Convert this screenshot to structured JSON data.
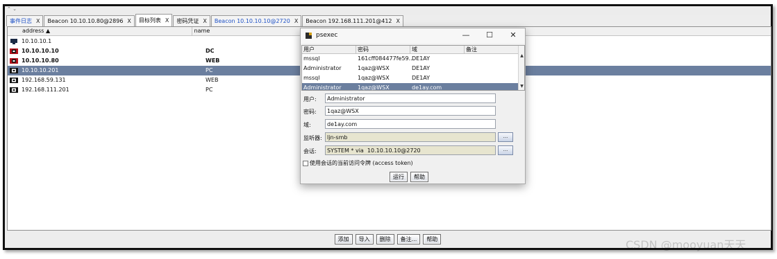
{
  "tabs": [
    {
      "label": "事件日志",
      "close": "X",
      "style": "blue"
    },
    {
      "label": "Beacon 10.10.10.80@2896",
      "close": "X",
      "style": ""
    },
    {
      "label": "目标列表",
      "close": "X",
      "style": "active"
    },
    {
      "label": "密码凭证",
      "close": "X",
      "style": ""
    },
    {
      "label": "Beacon 10.10.10.10@2720",
      "close": "X",
      "style": "blue"
    },
    {
      "label": "Beacon 192.168.111.201@412",
      "close": "X",
      "style": ""
    }
  ],
  "table": {
    "columns": {
      "address": "address ▲",
      "name": "name"
    },
    "rows": [
      {
        "address": "10.10.10.1",
        "name": "",
        "bold": false,
        "selected": false,
        "icon": "monitor-icon"
      },
      {
        "address": "10.10.10.10",
        "name": "DC",
        "bold": true,
        "selected": false,
        "icon": "windows-host-icon"
      },
      {
        "address": "10.10.10.80",
        "name": "WEB",
        "bold": true,
        "selected": false,
        "icon": "windows-host-icon"
      },
      {
        "address": "10.10.10.201",
        "name": "PC",
        "bold": false,
        "selected": true,
        "icon": "windows-host-icon"
      },
      {
        "address": "192.168.59.131",
        "name": "WEB",
        "bold": false,
        "selected": false,
        "icon": "windows-host-icon"
      },
      {
        "address": "192.168.111.201",
        "name": "PC",
        "bold": false,
        "selected": false,
        "icon": "windows-host-icon"
      }
    ]
  },
  "bottom_buttons": [
    {
      "label": "添加",
      "name": "add-button"
    },
    {
      "label": "导入",
      "name": "import-button"
    },
    {
      "label": "删除",
      "name": "delete-button"
    },
    {
      "label": "备注...",
      "name": "note-button"
    },
    {
      "label": "帮助",
      "name": "help-button"
    }
  ],
  "dialog": {
    "title": "psexec",
    "window_controls": {
      "minimize": "—",
      "maximize": "☐",
      "close": "✕"
    },
    "cred_columns": {
      "user": "用户",
      "password": "密码",
      "domain": "域",
      "note": "备注"
    },
    "cred_rows": [
      {
        "user": "mssql",
        "password": "161cff084477fe59...",
        "domain": "DE1AY",
        "note": "",
        "selected": false
      },
      {
        "user": "Administrator",
        "password": "1qaz@WSX",
        "domain": "DE1AY",
        "note": "",
        "selected": false
      },
      {
        "user": "mssql",
        "password": "1qaz@WSX",
        "domain": "DE1AY",
        "note": "",
        "selected": false
      },
      {
        "user": "Administrator",
        "password": "1qaz@WSX",
        "domain": "de1ay.com",
        "note": "",
        "selected": true
      }
    ],
    "labels": {
      "user": "用户:",
      "password": "密码:",
      "domain": "域:",
      "listener": "监听器:",
      "session": "会话:"
    },
    "values": {
      "user": "Administrator",
      "password": "1qaz@WSX",
      "domain": "de1ay.com",
      "listener": "ljn-smb",
      "session": "SYSTEM * via  10.10.10.10@2720"
    },
    "ellipsis": "...",
    "checkbox_label": "使用会话的当前访问令牌 (access token)",
    "checkbox_checked": false,
    "run_label": "运行",
    "help_label": "帮助"
  },
  "watermark": "CSDN @mooyuan天天",
  "colors": {
    "selection": "#6b7f9f",
    "tab_blue": "#1f52c6",
    "readonly_field": "#e7e5cf"
  }
}
